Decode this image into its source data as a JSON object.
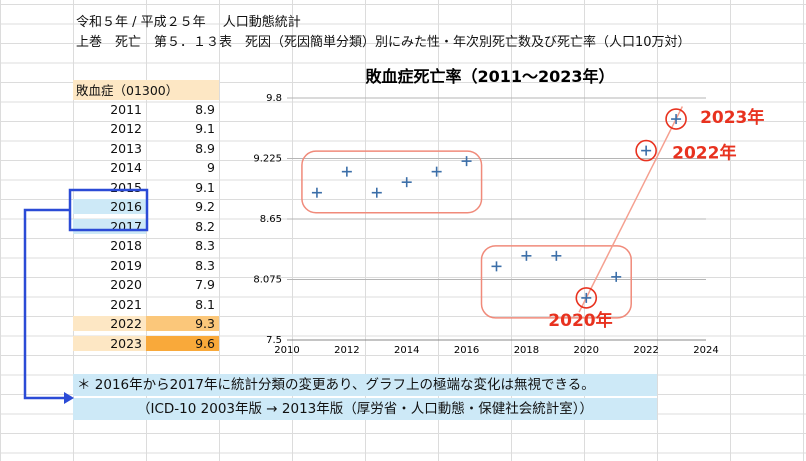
{
  "header": {
    "line1": "令和５年 / 平成２５年　 人口動態統計",
    "line2": "上巻　死亡　第５．１３表　死因（死因簡単分類）別にみた性・年次別死亡数及び死亡率（人口10万対）"
  },
  "table": {
    "title": "敗血症（01300）",
    "rows": [
      {
        "year": "2011",
        "value": "8.9"
      },
      {
        "year": "2012",
        "value": "9.1"
      },
      {
        "year": "2013",
        "value": "8.9"
      },
      {
        "year": "2014",
        "value": "9"
      },
      {
        "year": "2015",
        "value": "9.1"
      },
      {
        "year": "2016",
        "value": "9.2"
      },
      {
        "year": "2017",
        "value": "8.2"
      },
      {
        "year": "2018",
        "value": "8.3"
      },
      {
        "year": "2019",
        "value": "8.3"
      },
      {
        "year": "2020",
        "value": "7.9"
      },
      {
        "year": "2021",
        "value": "8.1"
      },
      {
        "year": "2022",
        "value": "9.3"
      },
      {
        "year": "2023",
        "value": "9.6"
      }
    ]
  },
  "chart_data": {
    "type": "scatter",
    "title": "敗血症死亡率（2011〜2023年）",
    "x": [
      2011,
      2012,
      2013,
      2014,
      2015,
      2016,
      2017,
      2018,
      2019,
      2020,
      2021,
      2022,
      2023
    ],
    "y": [
      8.9,
      9.1,
      8.9,
      9.0,
      9.1,
      9.2,
      8.2,
      8.3,
      8.3,
      7.9,
      8.1,
      9.3,
      9.6
    ],
    "xlim": [
      2010,
      2024
    ],
    "ylim": [
      7.5,
      9.8
    ],
    "xticks": [
      "2010",
      "2012",
      "2014",
      "2016",
      "2018",
      "2020",
      "2022",
      "2024"
    ],
    "yticks": [
      "7.5",
      "8.075",
      "8.65",
      "9.225",
      "9.8"
    ],
    "grid": "horizontal",
    "annotations": [
      {
        "label": "2020年",
        "x": 2020,
        "y": 7.9
      },
      {
        "label": "2022年",
        "x": 2022,
        "y": 9.3
      },
      {
        "label": "2023年",
        "x": 2023,
        "y": 9.6
      }
    ]
  },
  "notes": {
    "line1": "＊ 2016年から2017年に統計分類の変更あり、グラフ上の極端な変化は無視できる。",
    "line2": "（ICD-10 2003年版 → 2013年版（厚労省・人口動態・保健社会統計室））"
  },
  "colors": {
    "marker": "#3b6ea8",
    "annotation": "#e8321f",
    "group_box": "#f08a7a",
    "trend_line": "#f5a090",
    "arrow": "#2b4bd6",
    "year_highlight": "#cde9f7",
    "cell_2022": "#fbc77a",
    "cell_2023": "#f9a93a"
  }
}
